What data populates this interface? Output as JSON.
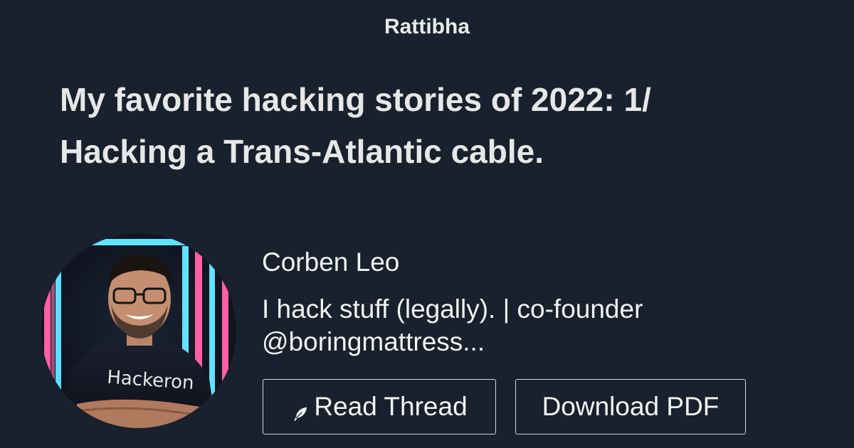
{
  "brand": "Rattibha",
  "thread": {
    "title": "My favorite hacking stories of 2022: 1/ Hacking a Trans-Atlantic cable."
  },
  "author": {
    "name": "Corben Leo",
    "bio_line1": "I hack stuff (legally). | co-founder",
    "bio_line2": "@boringmattress...",
    "avatar_shirt_text": "Hackeron"
  },
  "actions": {
    "read_label": "Read Thread",
    "pdf_label": "Download PDF",
    "read_icon": "feather-icon"
  },
  "colors": {
    "background": "#18212d",
    "text": "#eeeeee",
    "button_border": "#d7d7d7"
  }
}
